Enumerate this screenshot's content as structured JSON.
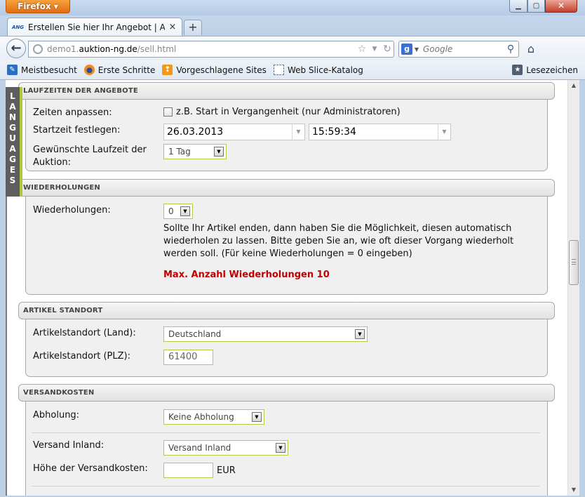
{
  "browser": {
    "app_button": "Firefox",
    "tab_title": "Erstellen Sie hier Ihr Angebot | Auktion:N...",
    "tab_favicon_text": "ANG",
    "url_gray_prefix": "demo1.",
    "url_domain": "auktion-ng.de",
    "url_path": "/sell.html",
    "search_placeholder": "Google",
    "icons": {
      "back": "back-arrow-icon",
      "star": "star-icon",
      "reload": "reload-icon",
      "search_go": "magnifier-icon",
      "home": "home-icon",
      "new_tab": "plus-icon",
      "tab_close": "close-icon"
    }
  },
  "bookmarks": {
    "items": [
      {
        "label": "Meistbesucht"
      },
      {
        "label": "Erste Schritte"
      },
      {
        "label": "Vorgeschlagene Sites"
      },
      {
        "label": "Web Slice-Katalog"
      }
    ],
    "right_label": "Lesezeichen"
  },
  "sidebar": {
    "languages_letters": [
      "L",
      "A",
      "N",
      "G",
      "U",
      "A",
      "G",
      "E",
      "S"
    ]
  },
  "sections": {
    "laufzeiten": {
      "title": "LAUFZEITEN DER ANGEBOTE",
      "zeiten_label": "Zeiten anpassen:",
      "zeiten_checkbox_label": "z.B. Start in Vergangenheit (nur Administratoren)",
      "startzeit_label": "Startzeit festlegen:",
      "start_date": "26.03.2013",
      "start_time": "15:59:34",
      "laufzeit_label_line1": "Gewünschte Laufzeit der",
      "laufzeit_label_line2": "Auktion:",
      "laufzeit_value": "1 Tag"
    },
    "wiederholungen": {
      "title": "WIEDERHOLUNGEN",
      "label": "Wiederholungen:",
      "value": "0",
      "description_line1": "Sollte Ihr Artikel enden, dann haben Sie die Möglichkeit, diesen automatisch",
      "description_line2": "wiederholen zu lassen. Bitte geben Sie an, wie oft dieser Vorgang wiederholt",
      "description_line3": "werden soll. (Für keine Wiederholungen = 0 eingeben)",
      "max_note": "Max. Anzahl Wiederholungen 10",
      "max_note_color": "#c00000"
    },
    "standort": {
      "title": "ARTIKEL STANDORT",
      "land_label": "Artikelstandort (Land):",
      "land_value": "Deutschland",
      "plz_label": "Artikelstandort (PLZ):",
      "plz_value": "61400"
    },
    "versand": {
      "title": "VERSANDKOSTEN",
      "abholung_label": "Abholung:",
      "abholung_value": "Keine Abholung",
      "inland_label": "Versand Inland:",
      "inland_value": "Versand Inland",
      "kosten_label": "Höhe der Versandkosten:",
      "kosten_value": "",
      "currency": "EUR"
    }
  },
  "colors": {
    "accent_green": "#b8c94a",
    "firefox_orange": "#e8801f"
  }
}
